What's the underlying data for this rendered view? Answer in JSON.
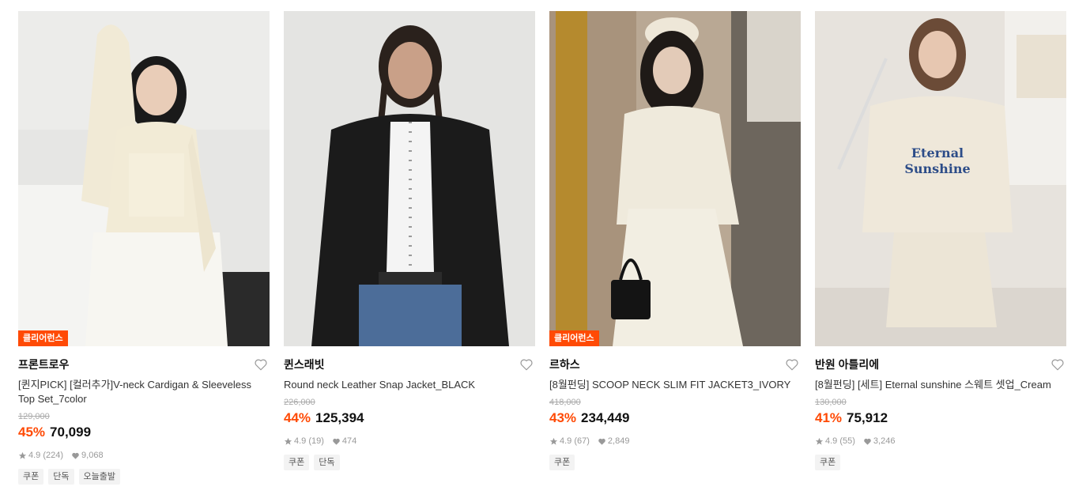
{
  "colors": {
    "accent": "#ff4a05",
    "badge_text": "#ffffff",
    "muted": "#999999"
  },
  "products": [
    {
      "badge": "클리어런스",
      "brand": "프론트로우",
      "title": "[퀸지PICK] [컬러추가]V-neck Cardigan & Sleeveless Top Set_7color",
      "original_price": "129,000",
      "discount": "45%",
      "price": "70,099",
      "rating": "4.9",
      "reviews": "(224)",
      "likes": "9,068",
      "tags": [
        "쿠폰",
        "단독",
        "오늘출발"
      ]
    },
    {
      "badge": "",
      "brand": "퀸스래빗",
      "title": "Round neck Leather Snap Jacket_BLACK",
      "original_price": "226,000",
      "discount": "44%",
      "price": "125,394",
      "rating": "4.9",
      "reviews": "(19)",
      "likes": "474",
      "tags": [
        "쿠폰",
        "단독"
      ]
    },
    {
      "badge": "클리어런스",
      "brand": "르하스",
      "title": "[8월펀딩] SCOOP NECK SLIM FIT JACKET3_IVORY",
      "original_price": "418,000",
      "discount": "43%",
      "price": "234,449",
      "rating": "4.9",
      "reviews": "(67)",
      "likes": "2,849",
      "tags": [
        "쿠폰"
      ]
    },
    {
      "badge": "",
      "brand": "반원 아틀리에",
      "title": "[8월펀딩] [세트] Eternal sunshine 스웨트 셋업_Cream",
      "original_price": "130,000",
      "discount": "41%",
      "price": "75,912",
      "rating": "4.9",
      "reviews": "(55)",
      "likes": "3,246",
      "tags": [
        "쿠폰"
      ]
    }
  ]
}
